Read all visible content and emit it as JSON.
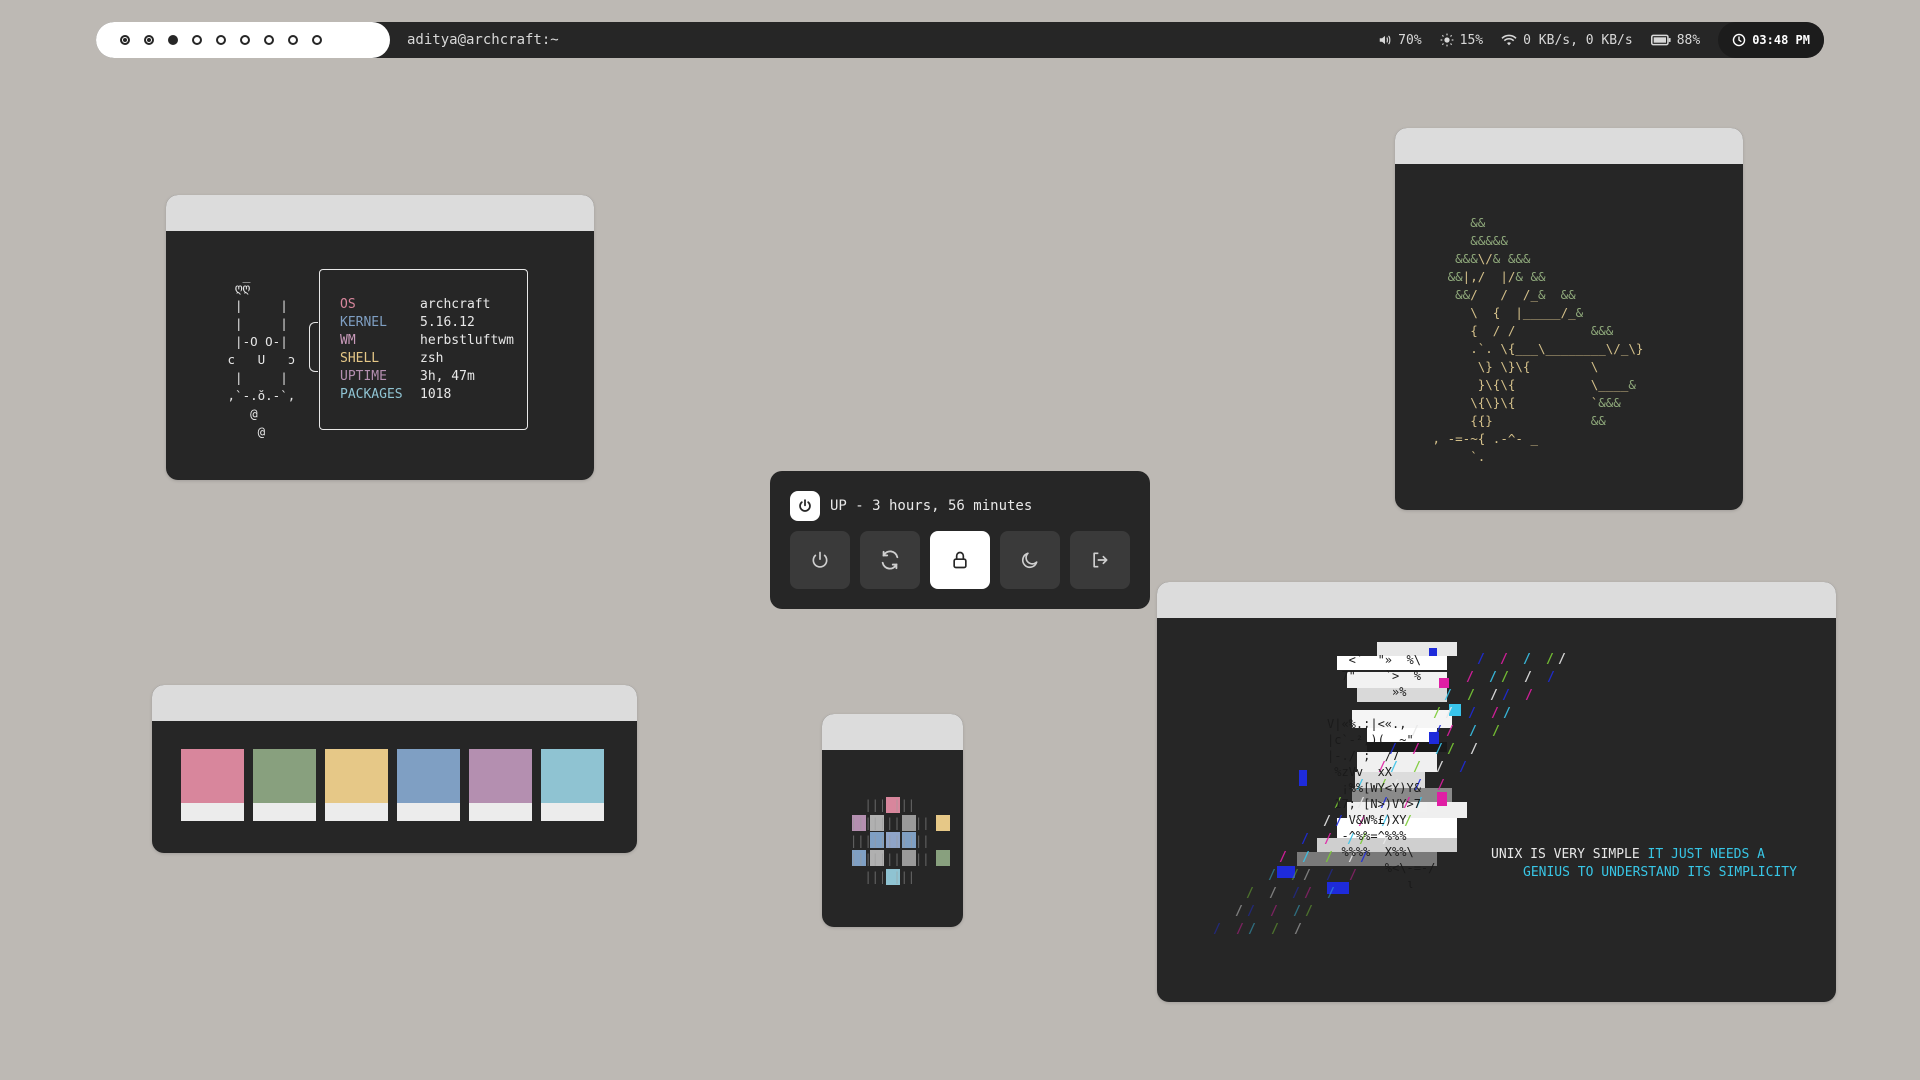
{
  "topbar": {
    "workspaces": [
      {
        "state": "occupied"
      },
      {
        "state": "occupied"
      },
      {
        "state": "active"
      },
      {
        "state": "empty"
      },
      {
        "state": "empty"
      },
      {
        "state": "empty"
      },
      {
        "state": "empty"
      },
      {
        "state": "empty"
      },
      {
        "state": "empty"
      }
    ],
    "window_title": "aditya@archcraft:~",
    "volume": "70%",
    "brightness": "15%",
    "network": "0 KB/s, 0 KB/s",
    "battery": "88%",
    "clock": "03:48 PM",
    "icons": {
      "volume": "volume-icon",
      "brightness": "brightness-icon",
      "network": "wifi-icon",
      "battery": "battery-icon",
      "clock": "clock-icon"
    }
  },
  "fetch": {
    "ascii": "  ღ̅̅̅̅̅̅̅̅̅ღ\n  |     |\n  |     |\n  |-O O-|\n ϲ   U   ɔ\n  |     |\n ,`-.ŏ.-`,\n    @\n     @",
    "info": [
      {
        "key": "OS",
        "value": "archcraft",
        "color": "#d8869c"
      },
      {
        "key": "KERNEL",
        "value": "5.16.12",
        "color": "#7f9fc3"
      },
      {
        "key": "WM",
        "value": "herbstluftwm",
        "color": "#c99aba"
      },
      {
        "key": "SHELL",
        "value": "zsh",
        "color": "#e6c887"
      },
      {
        "key": "UPTIME",
        "value": "3h, 47m",
        "color": "#b48fb0"
      },
      {
        "key": "PACKAGES",
        "value": "1018",
        "color": "#8fc3d2"
      }
    ]
  },
  "tree": {
    "ascii_green": "      &&\n      &&&&&\n    &&&\\/& &&&\n   &&|,/  |/& &&\n    &&/   /  /_&  &&\n\n\n\n\n\n\n\n              &&",
    "ascii": "      &&\n      &&&&&\n    &&&\\/& &&&\n   &&|,/  |/& &&\n    &&/   /  /_&  &&\n      \\  {  |_____/_&\n      {  / /          &&&\n      .`. \\{___\\________\\/_\\}\n       \\} \\}\\{        \\\n       }\\{\\{          \\____&\n      \\{\\}\\{          `&&&\n      {{}             &&\n , -=-~{ .-^- _\n      `."
  },
  "power": {
    "uptime_label": "UP - 3 hours, 56 minutes",
    "buttons": [
      {
        "name": "shutdown",
        "icon": "power-icon",
        "selected": false
      },
      {
        "name": "reboot",
        "icon": "refresh-icon",
        "selected": false
      },
      {
        "name": "lock",
        "icon": "lock-icon",
        "selected": true
      },
      {
        "name": "suspend",
        "icon": "moon-icon",
        "selected": false
      },
      {
        "name": "logout",
        "icon": "logout-icon",
        "selected": false
      }
    ]
  },
  "palette": {
    "colors": [
      "#d8869c",
      "#88a07e",
      "#e6c887",
      "#7f9fc3",
      "#b48fb0",
      "#8fc3d2"
    ]
  },
  "unix": {
    "quote_white": "UNIX IS VERY SIMPLE ",
    "quote_cyan_1": "IT JUST NEEDS A",
    "quote_cyan_2": "GENIUS TO UNDERSTAND ITS SIMPLICITY"
  }
}
